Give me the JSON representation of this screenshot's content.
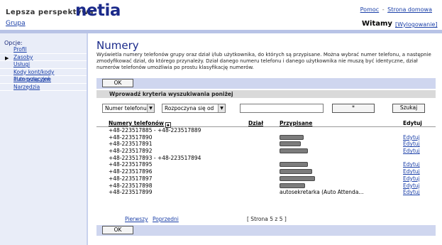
{
  "header": {
    "brand_tag": "Lepsza perspektywa",
    "brand_logo": "netia",
    "top_links": {
      "help": "Pomoc",
      "sep": "-",
      "home": "Strona domowa"
    },
    "group_link": "Grupa",
    "welcome": "Witamy",
    "logout": "[Wylogowanie]"
  },
  "sidebar": {
    "title": "Opcje:",
    "items": [
      {
        "label": "Profil",
        "active": false
      },
      {
        "label": "Zasoby",
        "active": true
      },
      {
        "label": "Usługi",
        "active": false
      },
      {
        "label": "Kody kont/kody autoryzacyjne",
        "active": false
      },
      {
        "label": "Plan połączeń",
        "active": false
      },
      {
        "label": "Narzędzia",
        "active": false
      }
    ]
  },
  "main": {
    "title": "Numery",
    "description": "Wyświetla numery telefonów grupy oraz dział i/lub użytkownika, do których są przypisane. Można wybrać numer telefonu, a następnie zmodyfikować dział, do którego przynależy. Dział danego numeru telefonu i danego użytkownika nie muszą być identyczne, dział numerów telefonów umożliwia po prostu klasyfikację numerów.",
    "ok_label": "OK",
    "criteria_title": "Wprowadź kryteria wyszukiwania poniżej",
    "search": {
      "field_value": "Numer telefonu",
      "match_value": "Rozpoczyna się od",
      "input_value": "",
      "star_label": "*",
      "search_label": "Szukaj"
    },
    "table": {
      "columns": {
        "number": "Numery telefonów",
        "dept": "Dział",
        "assigned": "Przypisane",
        "edit": "Edytuj"
      },
      "rows": [
        {
          "number": "+48-223517885 - +48-223517889",
          "assigned": "",
          "redacted": false,
          "edit": ""
        },
        {
          "number": "+48-223517890",
          "assigned": "",
          "redacted": true,
          "edit": "Edytuj"
        },
        {
          "number": "+48-223517891",
          "assigned": "",
          "redacted": true,
          "edit": "Edytuj"
        },
        {
          "number": "+48-223517892",
          "assigned": "",
          "redacted": true,
          "edit": "Edytuj"
        },
        {
          "number": "+48-223517893 - +48-223517894",
          "assigned": "",
          "redacted": false,
          "edit": ""
        },
        {
          "number": "+48-223517895",
          "assigned": "",
          "redacted": true,
          "edit": "Edytuj"
        },
        {
          "number": "+48-223517896",
          "assigned": "",
          "redacted": true,
          "edit": "Edytuj"
        },
        {
          "number": "+48-223517897",
          "assigned": "",
          "redacted": true,
          "edit": "Edytuj"
        },
        {
          "number": "+48-223517898",
          "assigned": "",
          "redacted": true,
          "edit": "Edytuj"
        },
        {
          "number": "+48-223517899",
          "assigned": "autosekretarka (Auto Attenda...",
          "redacted": false,
          "edit": "Edytuj"
        }
      ]
    },
    "pager": {
      "first": "Pierwszy",
      "prev": "Poprzedni",
      "status": "[ Strona 5 z 5 ]"
    }
  }
}
